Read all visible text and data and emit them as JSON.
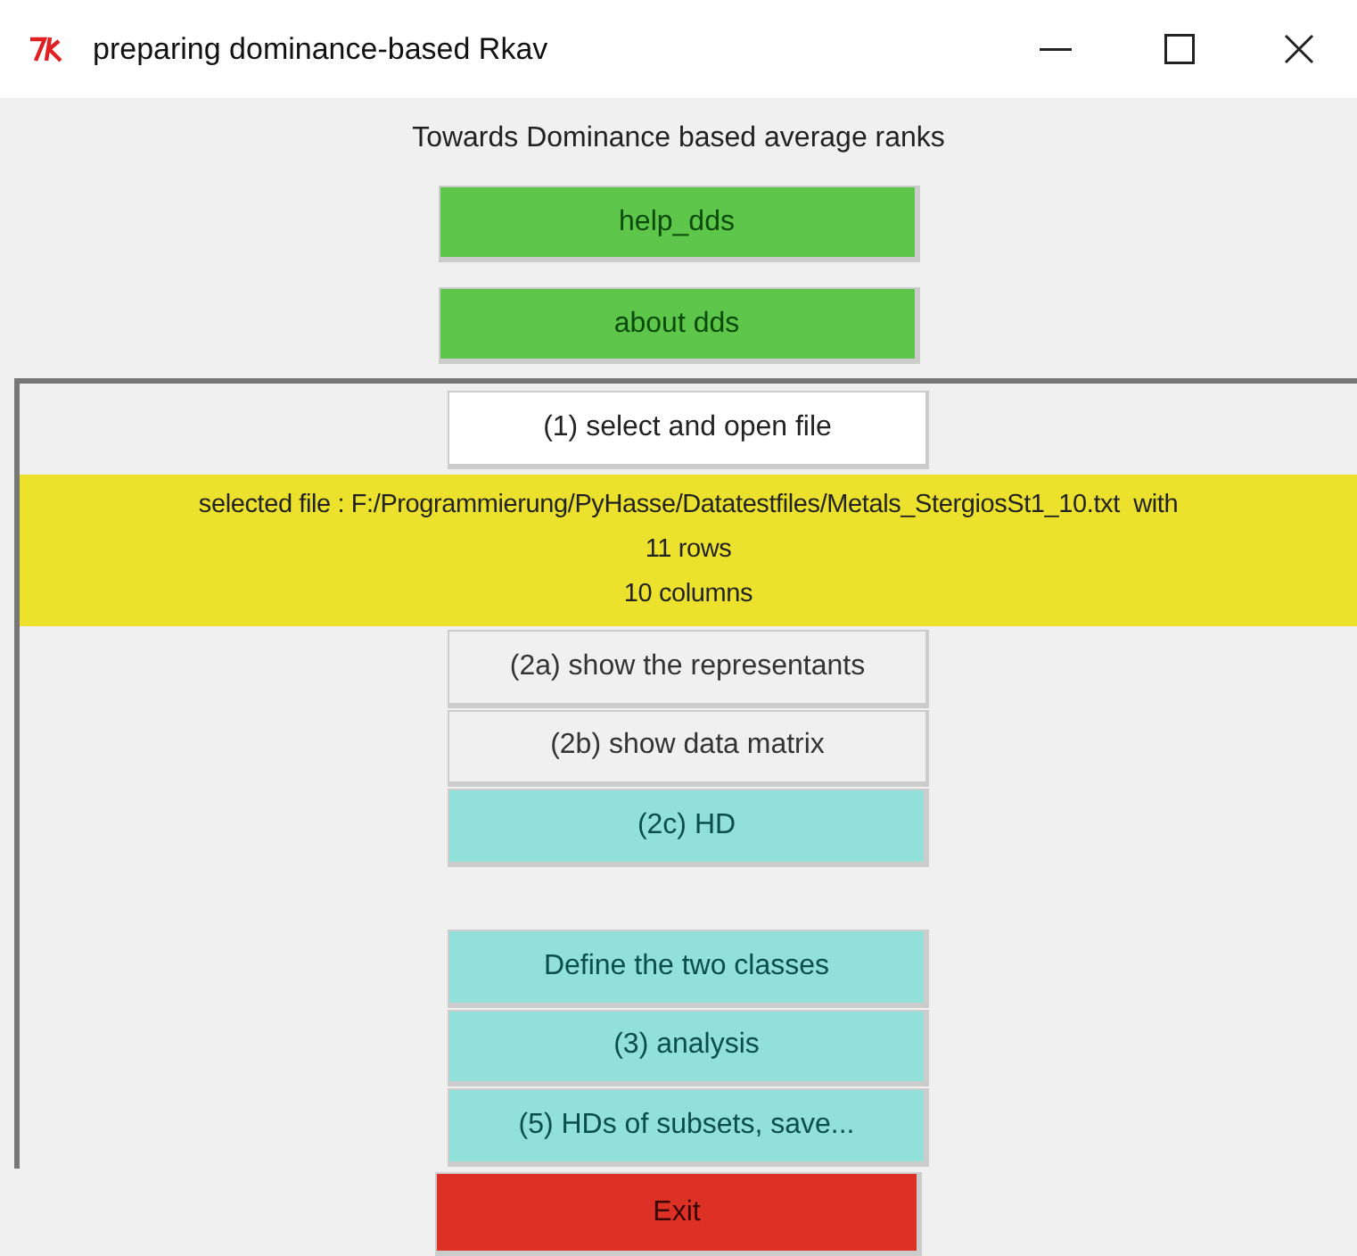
{
  "window": {
    "title": "preparing dominance-based Rkav"
  },
  "heading": "Towards Dominance based average ranks",
  "top_buttons": [
    {
      "label": "help_dds",
      "kind": "green"
    },
    {
      "label": "about dds",
      "kind": "green"
    }
  ],
  "frame": {
    "items": [
      {
        "kind": "white",
        "label": "(1) select and open file"
      },
      {
        "kind": "info",
        "lines": [
          "selected file : F:/Programmierung/PyHasse/Datatestfiles/Metals_StergiosSt1_10.txt  with",
          "11 rows",
          "10 columns"
        ]
      },
      {
        "kind": "plain",
        "label": "(2a) show the representants"
      },
      {
        "kind": "plain",
        "label": "(2b) show data matrix"
      },
      {
        "kind": "cyan",
        "label": "(2c) HD"
      },
      {
        "kind": "spacer"
      },
      {
        "kind": "cyan",
        "label": "Define the two classes"
      },
      {
        "kind": "cyan",
        "label": "(3) analysis"
      },
      {
        "kind": "cyan",
        "label": "(5) HDs of subsets, save..."
      }
    ]
  },
  "exit_button": {
    "label": "Exit",
    "kind": "red"
  }
}
